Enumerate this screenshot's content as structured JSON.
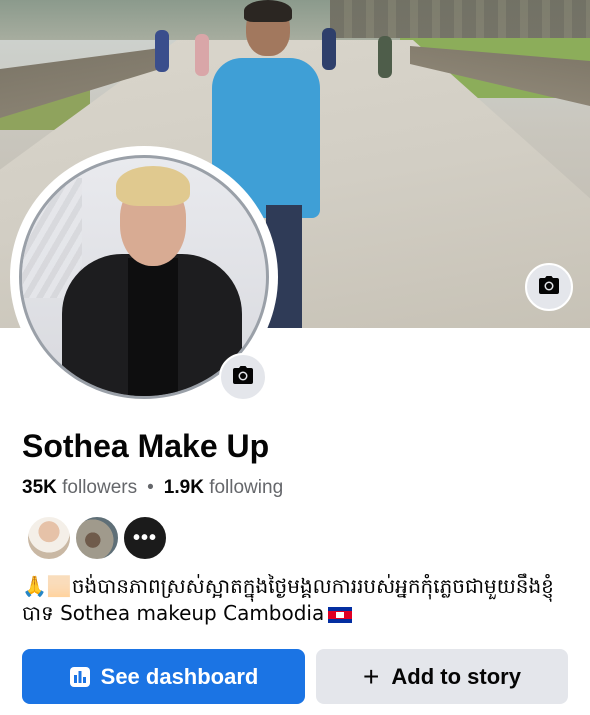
{
  "profile": {
    "name": "Sothea Make Up",
    "followers_count": "35K",
    "followers_label": "followers",
    "following_count": "1.9K",
    "following_label": "following",
    "mutual_more": "•••",
    "bio_emoji": "🙏🏻",
    "bio": "ចង់បានភាពស្រស់ស្អាតក្នុងថ្ងៃមង្គលការរបស់អ្នកកុំភ្លេចជាមួយនឹងខ្ញុំបាទ Sothea makeup Cambodia"
  },
  "actions": {
    "dashboard_label": "See dashboard",
    "add_story_label": "Add to story"
  },
  "icons": {
    "cover_camera": "camera-icon",
    "avatar_camera": "camera-icon",
    "dashboard": "bar-chart-icon",
    "add": "plus-icon",
    "flag": "cambodia-flag"
  },
  "colors": {
    "primary": "#1b74e4",
    "secondary_button": "#e4e6eb",
    "muted_text": "#65676b"
  }
}
